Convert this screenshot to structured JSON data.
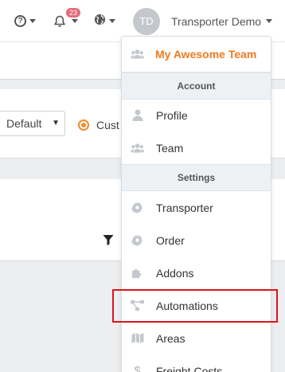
{
  "navbar": {
    "help_icon": "question-circle-icon",
    "help_glyph": "?",
    "notifications_icon": "bell-icon",
    "notifications_count": "23",
    "language_icon": "globe-icon",
    "avatar_initials": "TD",
    "user_name": "Transporter Demo"
  },
  "toolbar": {
    "select_value": "Default",
    "radio_label": "Cust",
    "filter_icon": "filter-icon"
  },
  "dropdown": {
    "team_name": "My Awesome Team",
    "account_header": "Account",
    "account_items": [
      {
        "label": "Profile",
        "icon": "user-icon"
      },
      {
        "label": "Team",
        "icon": "users-icon"
      }
    ],
    "settings_header": "Settings",
    "settings_items": [
      {
        "label": "Transporter",
        "icon": "gear-icon"
      },
      {
        "label": "Order",
        "icon": "gear-icon"
      },
      {
        "label": "Addons",
        "icon": "puzzle-icon"
      },
      {
        "label": "Automations",
        "icon": "flow-icon"
      },
      {
        "label": "Areas",
        "icon": "map-icon"
      },
      {
        "label": "Freight Costs",
        "icon": "dollar-icon"
      }
    ]
  },
  "colors": {
    "accent": "#f07a20",
    "badge": "#e46a76",
    "highlight": "#e0121c",
    "icon_gray": "#c3c8ce"
  }
}
